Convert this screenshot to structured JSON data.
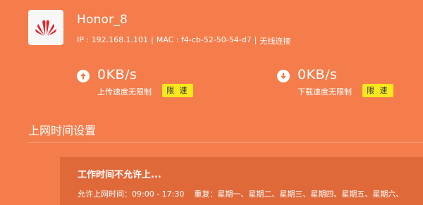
{
  "device": {
    "name": "Honor_8",
    "ip_label": "IP : 192.168.1.101",
    "separator": "|",
    "mac_label": "MAC : f4-cb-52-50-54-d7",
    "connection": "无线连接",
    "logo": "huawei-logo"
  },
  "upload": {
    "speed": "0KB/s",
    "status": "上传速度无限制",
    "button": "限 速",
    "icon": "arrow-up-circle-icon"
  },
  "download": {
    "speed": "0KB/s",
    "status": "下载速度无限制",
    "button": "限 速",
    "icon": "arrow-down-circle-icon"
  },
  "internet_time": {
    "section_title": "上网时间设置",
    "rule": {
      "title": "工作时间不允许上...",
      "allowed_time": "允许上网时间：09:00 - 17:30",
      "repeat": "重复：星期一、星期二、星期三、星期四、星期五、星期六、"
    }
  },
  "colors": {
    "background": "#f47d4b",
    "card": "#e0693a",
    "button": "#f8e71c",
    "logo_red": "#e0262e"
  }
}
